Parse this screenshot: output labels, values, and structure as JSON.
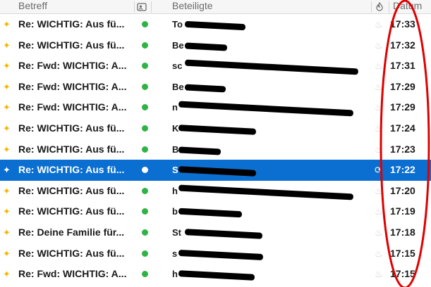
{
  "header": {
    "subject_label": "Betreff",
    "participants_label": "Beteiligte",
    "date_label": "Datum"
  },
  "colors": {
    "selection": "#0a6fd1",
    "star": "#f2b705",
    "online_dot": "#2fb345",
    "annotation": "#e00000"
  },
  "icons": {
    "header_participants": "contacts-column-icon",
    "header_thread": "thread-column-icon",
    "row_star": "star-icon",
    "row_status": "status-dot-icon",
    "row_thread": "thread-flame-icon"
  },
  "messages": [
    {
      "subject": "Re: WICHTIG: Aus fü...",
      "participants": "To",
      "redact_w": 86,
      "time": "17:33"
    },
    {
      "subject": "Re: WICHTIG: Aus fü...",
      "participants": "Be",
      "redact_w": 60,
      "time": "17:32"
    },
    {
      "subject": "Re: Fwd: WICHTIG: A...",
      "participants": "sc",
      "redact_w": 246,
      "time": "17:31"
    },
    {
      "subject": "Re: Fwd: WICHTIG: A...",
      "participants": "Be",
      "redact_w": 58,
      "time": "17:29"
    },
    {
      "subject": "Re: Fwd: WICHTIG: A...",
      "participants": "n",
      "redact_w": 248,
      "time": "17:29"
    },
    {
      "subject": "Re: WICHTIG: Aus fü...",
      "participants": "K",
      "redact_w": 110,
      "time": "17:24"
    },
    {
      "subject": "Re: WICHTIG: Aus fü...",
      "participants": "B",
      "redact_w": 60,
      "time": "17:23"
    },
    {
      "subject": "Re: WICHTIG: Aus fü...",
      "participants": "S",
      "redact_w": 110,
      "time": "17:22",
      "selected": true
    },
    {
      "subject": "Re: WICHTIG: Aus fü...",
      "participants": "h",
      "redact_w": 248,
      "time": "17:20"
    },
    {
      "subject": "Re: WICHTIG: Aus fü...",
      "participants": "b",
      "redact_w": 90,
      "time": "17:19"
    },
    {
      "subject": "Re: Deine Familie für...",
      "participants": "St",
      "redact_w": 110,
      "time": "17:18"
    },
    {
      "subject": "Re: WICHTIG: Aus fü...",
      "participants": "s",
      "redact_w": 120,
      "time": "17:15"
    },
    {
      "subject": "Re: Fwd: WICHTIG: A...",
      "participants": "h",
      "redact_w": 108,
      "time": "17:15"
    }
  ]
}
